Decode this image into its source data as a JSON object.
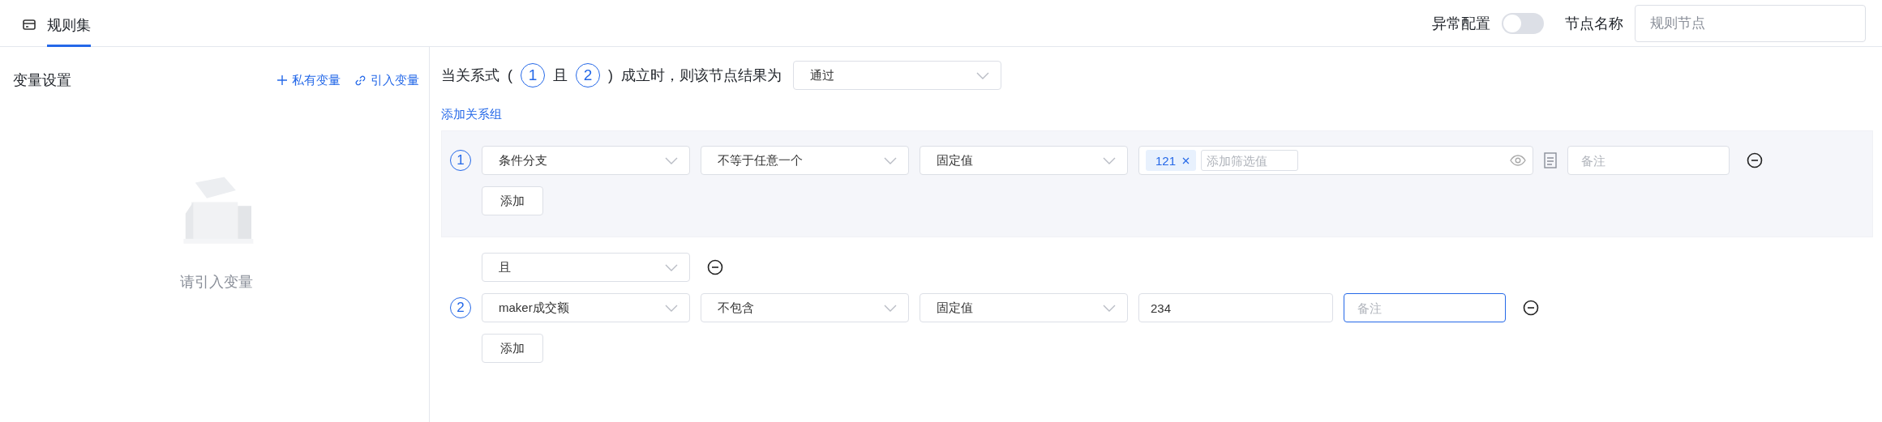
{
  "header": {
    "tab": {
      "label": "规则集",
      "selected": true
    },
    "exception_config": {
      "label": "异常配置",
      "on": false
    },
    "node_name": {
      "label": "节点名称",
      "placeholder": "规则节点"
    }
  },
  "variables_panel": {
    "title": "变量设置",
    "actions": [
      {
        "kind": "plus",
        "label": "私有变量"
      },
      {
        "kind": "link",
        "label": "引入变量"
      }
    ],
    "empty_text": "请引入变量"
  },
  "relation": {
    "before": "当关系式",
    "open": "(",
    "parts": [
      {
        "kind": "badge",
        "text": "1"
      },
      {
        "kind": "text",
        "text": "且"
      },
      {
        "kind": "badge",
        "text": "2"
      }
    ],
    "close": ")",
    "after": "成立时，则该节点结果为",
    "result": "通过"
  },
  "add_group_link": "添加关系组",
  "groups": [
    {
      "index": "1",
      "selected": true,
      "conditions": [
        {
          "field": "条件分支",
          "operator": "不等于任意一个",
          "value_type": "固定值",
          "value": {
            "kind": "tags",
            "tags": [
              "121"
            ],
            "placeholder": "添加筛选值"
          },
          "note": {
            "placeholder": "备注",
            "focused": false
          }
        }
      ],
      "add_button": "添加"
    },
    {
      "index": "2",
      "selected": false,
      "connector": "且",
      "conditions": [
        {
          "field": "maker成交额",
          "operator": "不包含",
          "value_type": "固定值",
          "value": {
            "kind": "text",
            "text": "234"
          },
          "note": {
            "placeholder": "备注",
            "focused": true
          }
        }
      ],
      "add_button": "添加"
    }
  ]
}
